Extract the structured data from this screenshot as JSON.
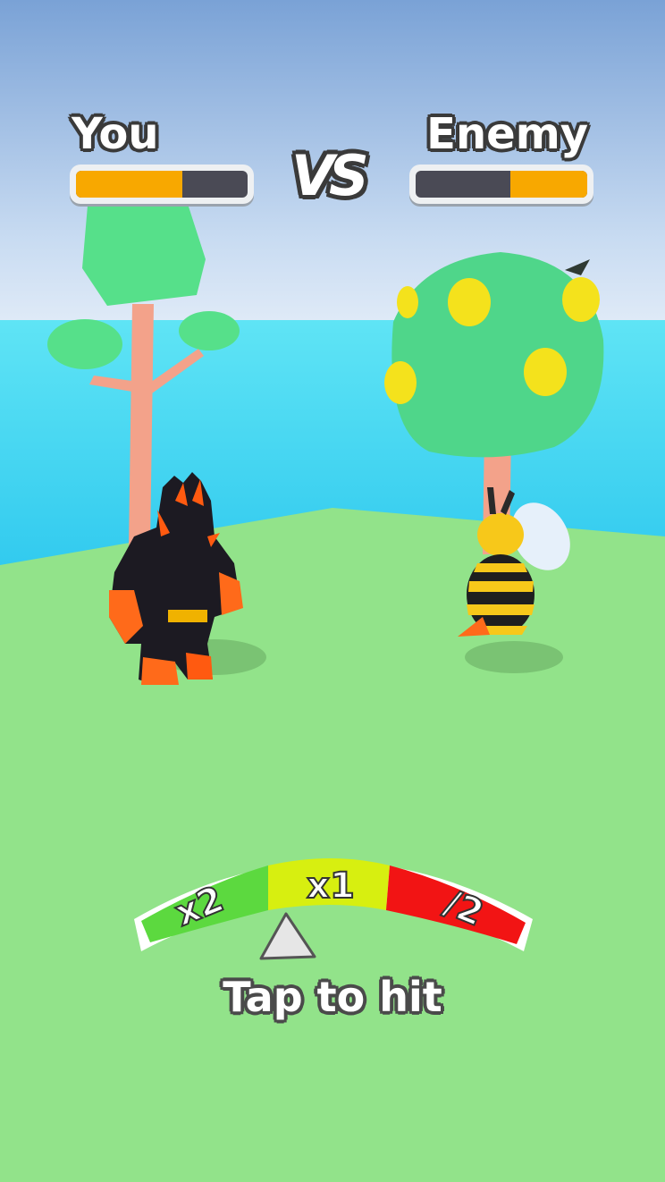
{
  "hud": {
    "player_label": "You",
    "enemy_label": "Enemy",
    "vs_label": "VS",
    "player_health_fraction": 0.62,
    "enemy_health_fraction": 0.45,
    "health_color": "#f8a800"
  },
  "meter": {
    "segments": [
      {
        "label": "x2",
        "color": "#5cd93f"
      },
      {
        "label": "x1",
        "color": "#d7ef10"
      },
      {
        "label": "/2",
        "color": "#f21414"
      }
    ],
    "pointer_position_fraction": 0.27
  },
  "prompt": {
    "text": "Tap to hit"
  },
  "colors": {
    "sky_top": "#7aa2d6",
    "sea": "#3fd8f2",
    "ground": "#92e38a"
  }
}
